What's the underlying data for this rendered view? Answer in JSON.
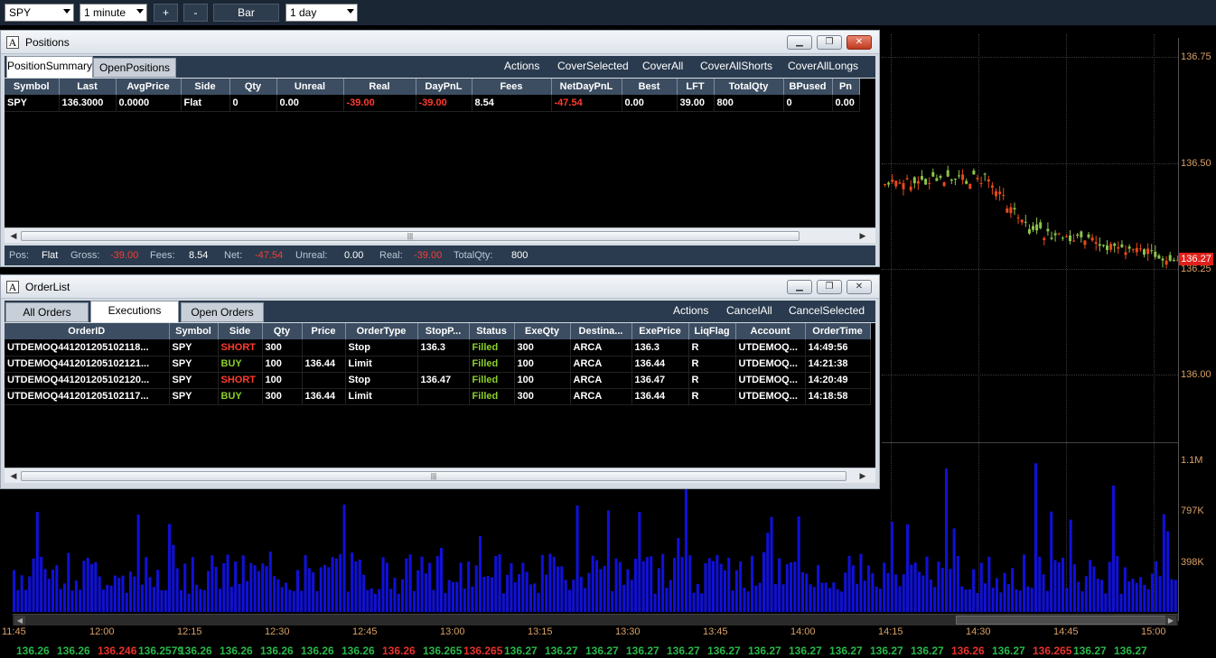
{
  "toolbar": {
    "symbol": "SPY",
    "interval": "1 minute",
    "plus_label": "+",
    "minus_label": "-",
    "chart_type": "Bar",
    "range": "1 day"
  },
  "chart": {
    "price_labels": [
      "136.75",
      "136.50",
      "136.25",
      "136.00"
    ],
    "last_price_tag": "136.27",
    "volume_labels": [
      "1.1M",
      "797K",
      "398K"
    ],
    "time_labels": [
      "11:45",
      "12:00",
      "12:15",
      "12:30",
      "12:45",
      "13:00",
      "13:15",
      "13:30",
      "13:45",
      "14:00",
      "14:15",
      "14:30",
      "14:45",
      "15:00"
    ],
    "colors": {
      "up": "#8bc34a",
      "down": "#e64a19",
      "volume": "#1010d8",
      "axis_text": "#d9a066"
    }
  },
  "ticker": [
    {
      "v": "136.26",
      "c": "green"
    },
    {
      "v": "136.26",
      "c": "green"
    },
    {
      "v": "136.246",
      "c": "red"
    },
    {
      "v": "136.2579",
      "c": "green"
    },
    {
      "v": "136.26",
      "c": "green"
    },
    {
      "v": "136.26",
      "c": "green"
    },
    {
      "v": "136.26",
      "c": "green"
    },
    {
      "v": "136.26",
      "c": "green"
    },
    {
      "v": "136.26",
      "c": "green"
    },
    {
      "v": "136.26",
      "c": "red"
    },
    {
      "v": "136.265",
      "c": "green"
    },
    {
      "v": "136.265",
      "c": "red"
    },
    {
      "v": "136.27",
      "c": "green"
    },
    {
      "v": "136.27",
      "c": "green"
    },
    {
      "v": "136.27",
      "c": "green"
    },
    {
      "v": "136.27",
      "c": "green"
    },
    {
      "v": "136.27",
      "c": "green"
    },
    {
      "v": "136.27",
      "c": "green"
    },
    {
      "v": "136.27",
      "c": "green"
    },
    {
      "v": "136.27",
      "c": "green"
    },
    {
      "v": "136.27",
      "c": "green"
    },
    {
      "v": "136.27",
      "c": "green"
    },
    {
      "v": "136.27",
      "c": "green"
    },
    {
      "v": "136.26",
      "c": "red"
    },
    {
      "v": "136.27",
      "c": "green"
    },
    {
      "v": "136.265",
      "c": "red"
    },
    {
      "v": "136.27",
      "c": "green"
    },
    {
      "v": "136.27",
      "c": "green"
    }
  ],
  "positions": {
    "title": "Positions",
    "tabs": [
      "PositionSummary",
      "OpenPositions"
    ],
    "actions": [
      "Actions",
      "CoverSelected",
      "CoverAll",
      "CoverAllShorts",
      "CoverAllLongs"
    ],
    "columns": [
      "Symbol",
      "Last",
      "AvgPrice",
      "Side",
      "Qty",
      "Unreal",
      "Real",
      "DayPnL",
      "Fees",
      "NetDayPnL",
      "Best",
      "LFT",
      "TotalQty",
      "BPused",
      "Pn"
    ],
    "rows": [
      [
        "SPY",
        "136.3000",
        "0.0000",
        "Flat",
        "0",
        "0.00",
        "-39.00",
        "-39.00",
        "8.54",
        "-47.54",
        "0.00",
        "39.00",
        "800",
        "0",
        "0.00"
      ]
    ],
    "status": {
      "pos_label": "Pos:",
      "pos": "Flat",
      "gross_label": "Gross:",
      "gross": "-39.00",
      "fees_label": "Fees:",
      "fees": "8.54",
      "net_label": "Net:",
      "net": "-47.54",
      "unreal_label": "Unreal:",
      "unreal": "0.00",
      "real_label": "Real:",
      "real": "-39.00",
      "totalqty_label": "TotalQty:",
      "totalqty": "800"
    }
  },
  "orderlist": {
    "title": "OrderList",
    "tabs": [
      "All Orders",
      "Executions",
      "Open Orders"
    ],
    "actions": [
      "Actions",
      "CancelAll",
      "CancelSelected"
    ],
    "columns": [
      "OrderID",
      "Symbol",
      "Side",
      "Qty",
      "Price",
      "OrderType",
      "StopP...",
      "Status",
      "ExeQty",
      "Destina...",
      "ExePrice",
      "LiqFlag",
      "Account",
      "OrderTime"
    ],
    "rows": [
      [
        "UTDEMOQ441201205102118...",
        "SPY",
        "SHORT",
        "300",
        "",
        "Stop",
        "136.3",
        "Filled",
        "300",
        "ARCA",
        "136.3",
        "R",
        "UTDEMOQ...",
        "14:49:56"
      ],
      [
        "UTDEMOQ441201205102121...",
        "SPY",
        "BUY",
        "100",
        "136.44",
        "Limit",
        "",
        "Filled",
        "100",
        "ARCA",
        "136.44",
        "R",
        "UTDEMOQ...",
        "14:21:38"
      ],
      [
        "UTDEMOQ441201205102120...",
        "SPY",
        "SHORT",
        "100",
        "",
        "Stop",
        "136.47",
        "Filled",
        "100",
        "ARCA",
        "136.47",
        "R",
        "UTDEMOQ...",
        "14:20:49"
      ],
      [
        "UTDEMOQ441201205102117...",
        "SPY",
        "BUY",
        "300",
        "136.44",
        "Limit",
        "",
        "Filled",
        "300",
        "ARCA",
        "136.44",
        "R",
        "UTDEMOQ...",
        "14:18:58"
      ]
    ]
  }
}
